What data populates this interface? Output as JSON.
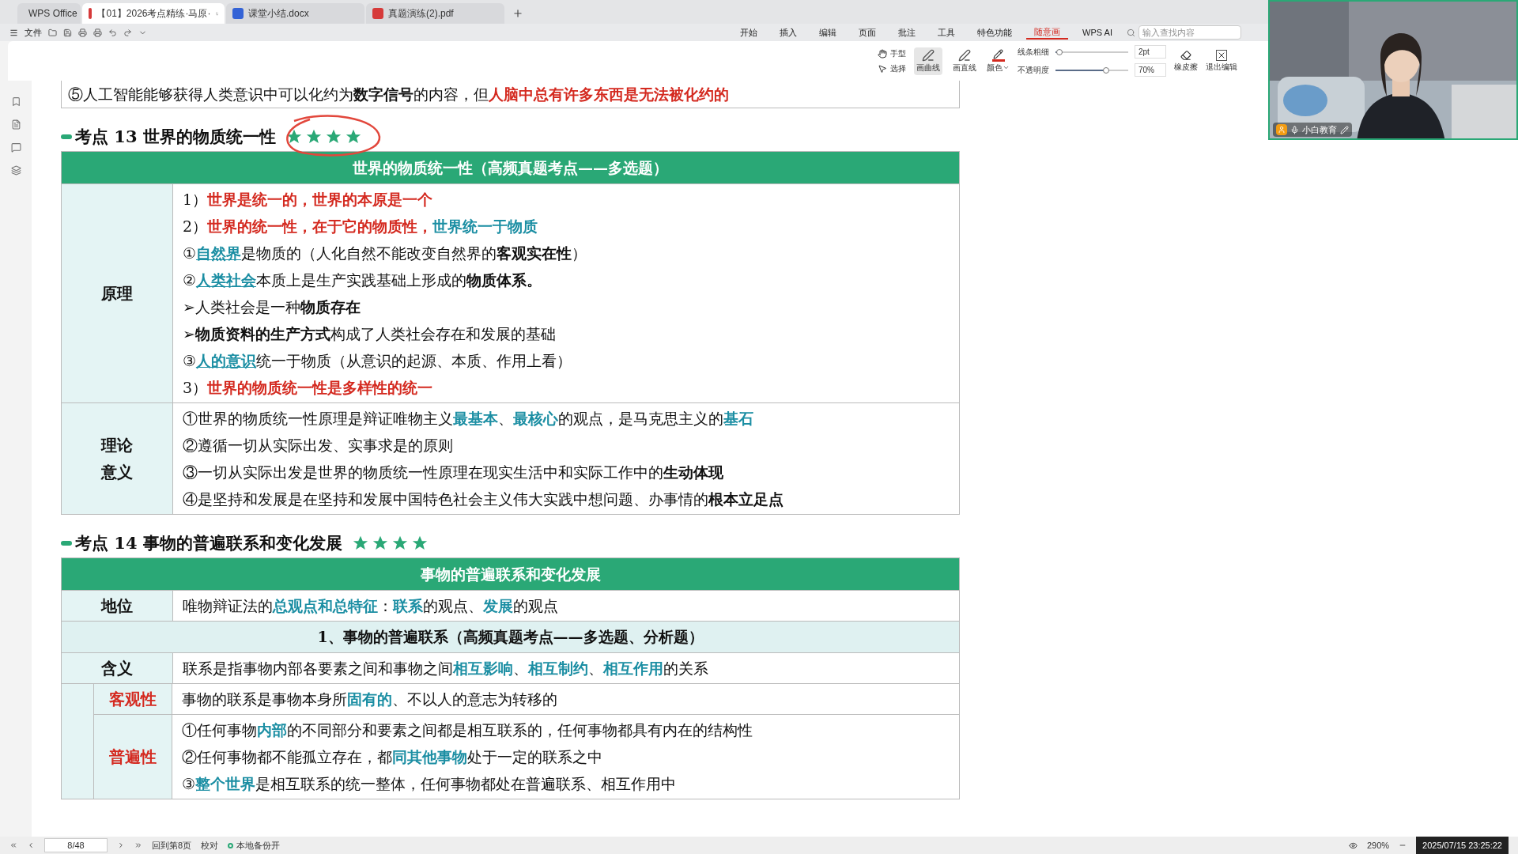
{
  "tabs": [
    {
      "label": "WPS Office",
      "kind": "home",
      "selected": false
    },
    {
      "label": "【01】2026考点精练·马原·",
      "kind": "pdf",
      "selected": true
    },
    {
      "label": "课堂小结.docx",
      "kind": "word",
      "selected": false
    },
    {
      "label": "真题演练(2).pdf",
      "kind": "pdf",
      "selected": false
    }
  ],
  "file_menu": "文件",
  "ribbon": [
    {
      "label": "开始",
      "selected": false
    },
    {
      "label": "插入",
      "selected": false
    },
    {
      "label": "编辑",
      "selected": false
    },
    {
      "label": "页面",
      "selected": false
    },
    {
      "label": "批注",
      "selected": false
    },
    {
      "label": "工具",
      "selected": false
    },
    {
      "label": "特色功能",
      "selected": false
    },
    {
      "label": "随意画",
      "selected": true
    },
    {
      "label": "WPS AI",
      "selected": false
    }
  ],
  "search": {
    "placeholder": "输入查找内容"
  },
  "tools": {
    "hand": "手型",
    "select": "选择",
    "curve": {
      "label": "画曲线",
      "selected": true
    },
    "line": {
      "label": "画直线",
      "selected": false
    },
    "color_label": "颜色",
    "width": {
      "label": "线条粗细",
      "level": 0.05,
      "value": "2pt"
    },
    "opacity": {
      "label": "不透明度",
      "level": 0.7,
      "value": "70%"
    },
    "eraser": "橡皮擦",
    "exit": "退出编辑"
  },
  "document": {
    "note": [
      {
        "text": "⑤人工智能能够获得人类意识中可以化约为",
        "kind": "plain"
      },
      {
        "text": "数字信号",
        "kind": "bold"
      },
      {
        "text": "的内容，但",
        "kind": "plain"
      },
      {
        "text": "人脑中总有许多东西是无法被化约的",
        "kind": "red"
      }
    ],
    "sections": [
      {
        "heading": "考点 13  世界的物质统一性",
        "stars": 4,
        "table_title": "世界的物质统一性（高频真题考点——多选题）",
        "rows": [
          {
            "kind": "row",
            "label": [
              "原理"
            ],
            "lines": [
              [
                {
                  "text": "1）",
                  "kind": "plain"
                },
                {
                  "text": "世界是统一的，世界的本原是一个",
                  "kind": "red"
                }
              ],
              [
                {
                  "text": "2）",
                  "kind": "plain"
                },
                {
                  "text": "世界的统一性，在于它的物质性，",
                  "kind": "red"
                },
                {
                  "text": "世界统一于物质",
                  "kind": "teal"
                }
              ],
              [
                {
                  "text": "①",
                  "kind": "plain"
                },
                {
                  "text": "自然界",
                  "kind": "link"
                },
                {
                  "text": "是物质的（人化自然不能改变自然界的",
                  "kind": "plain"
                },
                {
                  "text": "客观实在性",
                  "kind": "bold"
                },
                {
                  "text": "）",
                  "kind": "plain"
                }
              ],
              [
                {
                  "text": "②",
                  "kind": "plain"
                },
                {
                  "text": "人类社会",
                  "kind": "link"
                },
                {
                  "text": "本质上是生产实践基础上形成的",
                  "kind": "plain"
                },
                {
                  "text": "物质体系。",
                  "kind": "bold"
                }
              ],
              [
                {
                  "text": "➢人类社会是一种",
                  "kind": "plain"
                },
                {
                  "text": "物质存在",
                  "kind": "bold"
                }
              ],
              [
                {
                  "text": "➢",
                  "kind": "plain"
                },
                {
                  "text": "物质资料的生产方式",
                  "kind": "bold"
                },
                {
                  "text": "构成了人类社会存在和发展的基础",
                  "kind": "plain"
                }
              ],
              [
                {
                  "text": "③",
                  "kind": "plain"
                },
                {
                  "text": "人的意识",
                  "kind": "link"
                },
                {
                  "text": "统一于物质（从意识的起源、本质、作用上看）",
                  "kind": "plain"
                }
              ],
              [
                {
                  "text": "3）",
                  "kind": "plain"
                },
                {
                  "text": "世界的物质统一性是多样性的统一",
                  "kind": "red"
                }
              ]
            ]
          },
          {
            "kind": "row",
            "label": [
              "理论",
              "意义"
            ],
            "lines": [
              [
                {
                  "text": "①世界的物质统一性原理是辩证唯物主义",
                  "kind": "plain"
                },
                {
                  "text": "最基本",
                  "kind": "teal"
                },
                {
                  "text": "、",
                  "kind": "plain"
                },
                {
                  "text": "最核心",
                  "kind": "teal"
                },
                {
                  "text": "的观点，是马克思主义的",
                  "kind": "plain"
                },
                {
                  "text": "基石",
                  "kind": "teal"
                }
              ],
              [
                {
                  "text": "②遵循一切从实际出发、实事求是的原则",
                  "kind": "plain"
                }
              ],
              [
                {
                  "text": "③一切从实际出发是世界的物质统一性原理在现实生活中和实际工作中的",
                  "kind": "plain"
                },
                {
                  "text": "生动体现",
                  "kind": "bold"
                }
              ],
              [
                {
                  "text": "④是坚持和发展是在坚持和发展中国特色社会主义伟大实践中想问题、办事情的",
                  "kind": "plain"
                },
                {
                  "text": "根本立足点",
                  "kind": "bold"
                }
              ]
            ]
          }
        ]
      },
      {
        "heading": "考点 14  事物的普遍联系和变化发展",
        "stars": 4,
        "table_title": "事物的普遍联系和变化发展",
        "rows": [
          {
            "kind": "row",
            "label": [
              "地位"
            ],
            "lines": [
              [
                {
                  "text": "唯物辩证法的",
                  "kind": "plain"
                },
                {
                  "text": "总观点和总特征",
                  "kind": "teal"
                },
                {
                  "text": "：",
                  "kind": "plain"
                },
                {
                  "text": "联系",
                  "kind": "teal"
                },
                {
                  "text": "的观点、",
                  "kind": "plain"
                },
                {
                  "text": "发展",
                  "kind": "teal"
                },
                {
                  "text": "的观点",
                  "kind": "plain"
                }
              ]
            ]
          },
          {
            "kind": "subheader",
            "title": "1、事物的普遍联系（高频真题考点——多选题、分析题）"
          },
          {
            "kind": "row",
            "label": [
              "含义"
            ],
            "lines": [
              [
                {
                  "text": "联系是指事物内部各要素之间和事物之间",
                  "kind": "plain"
                },
                {
                  "text": "相互影响",
                  "kind": "teal"
                },
                {
                  "text": "、",
                  "kind": "plain"
                },
                {
                  "text": "相互制约",
                  "kind": "teal"
                },
                {
                  "text": "、",
                  "kind": "plain"
                },
                {
                  "text": "相互作用",
                  "kind": "teal"
                },
                {
                  "text": "的关系",
                  "kind": "plain"
                }
              ]
            ]
          },
          {
            "kind": "group",
            "items": [
              {
                "label": "客观性",
                "lines": [
                  [
                    {
                      "text": "事物的联系是事物本身所",
                      "kind": "plain"
                    },
                    {
                      "text": "固有的",
                      "kind": "teal"
                    },
                    {
                      "text": "、不以人的意志为转移的",
                      "kind": "plain"
                    }
                  ]
                ]
              },
              {
                "label": "普遍性",
                "lines": [
                  [
                    {
                      "text": "①任何事物",
                      "kind": "plain"
                    },
                    {
                      "text": "内部",
                      "kind": "teal"
                    },
                    {
                      "text": "的不同部分和要素之间都是相互联系的，任何事物都具有内在的结构性",
                      "kind": "plain"
                    }
                  ],
                  [
                    {
                      "text": "②任何事物都不能孤立存在，都",
                      "kind": "plain"
                    },
                    {
                      "text": "同其他事物",
                      "kind": "teal"
                    },
                    {
                      "text": "处于一定的联系之中",
                      "kind": "plain"
                    }
                  ],
                  [
                    {
                      "text": "③",
                      "kind": "plain"
                    },
                    {
                      "text": "整个世界",
                      "kind": "teal"
                    },
                    {
                      "text": "是相互联系的统一整体，任何事物都处在普遍联系、相互作用中",
                      "kind": "plain"
                    }
                  ]
                ]
              }
            ]
          }
        ]
      }
    ]
  },
  "status": {
    "page": "8/48",
    "back": "回到第8页",
    "proof": "校对",
    "backup": "本地备份开",
    "zoom": "290%",
    "datetime": "2025/07/15 23:25:22"
  },
  "webcam": {
    "name": "小白教育"
  }
}
